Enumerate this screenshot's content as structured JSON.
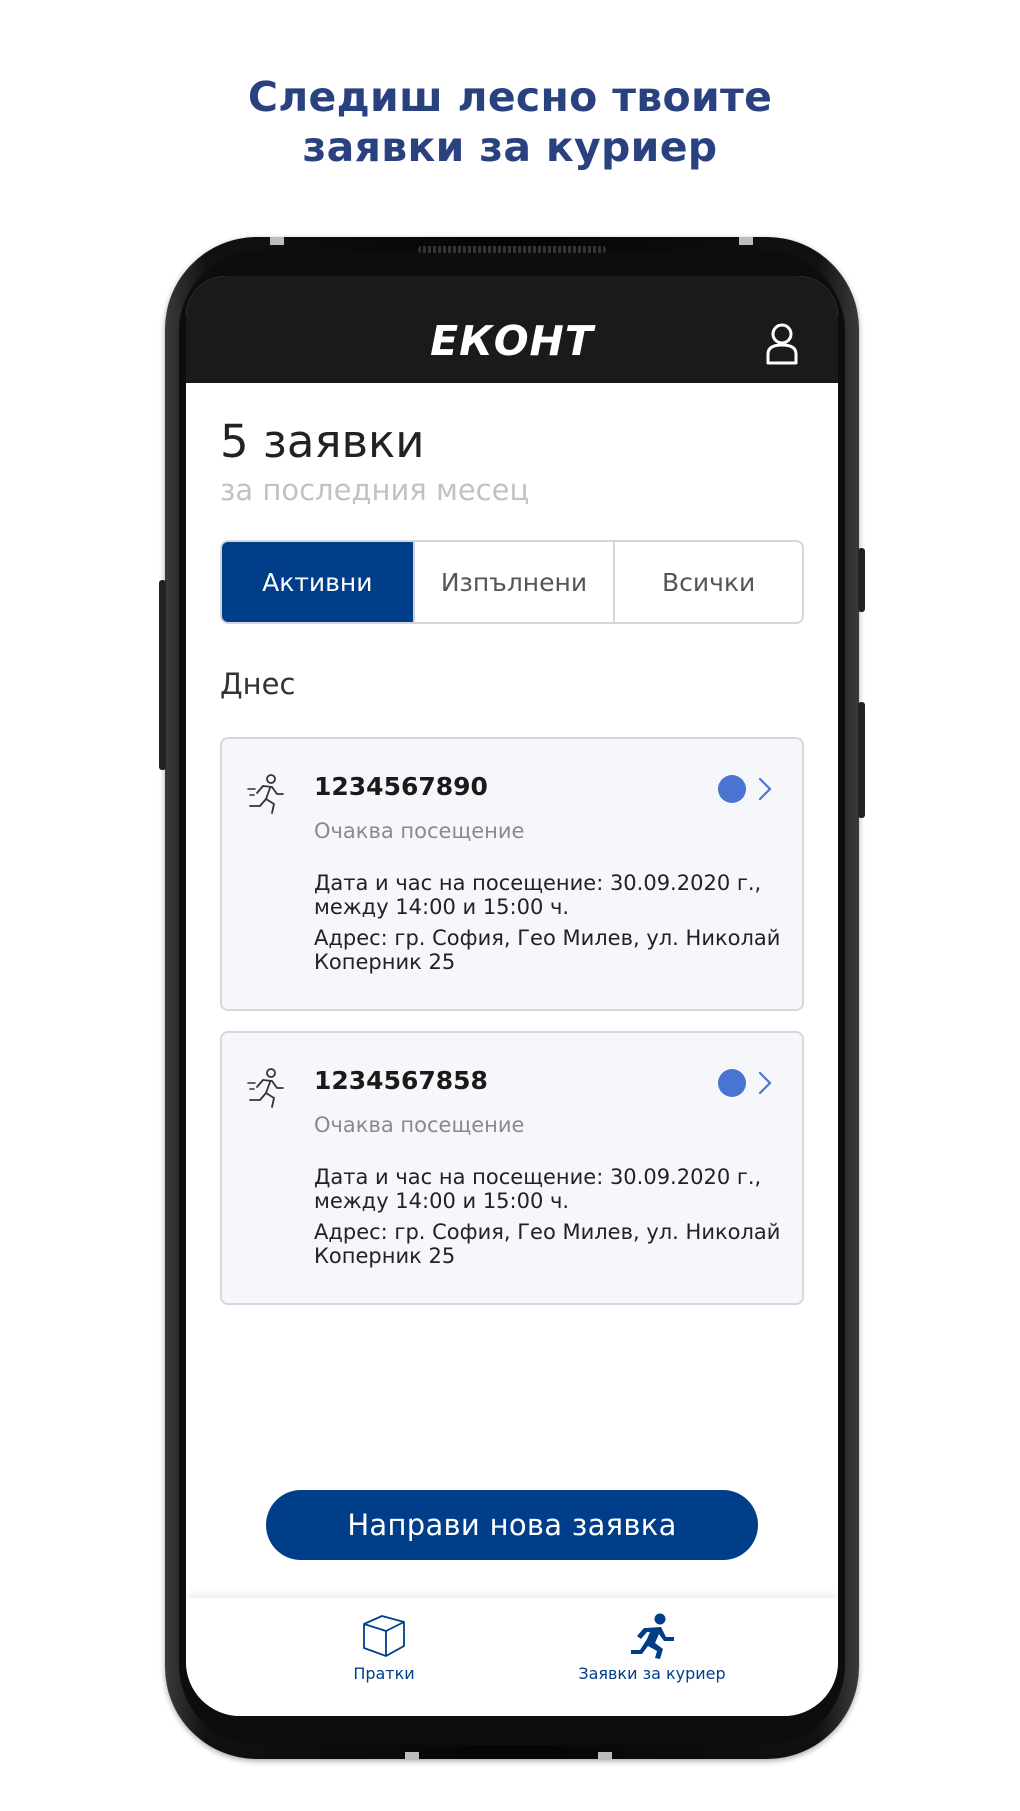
{
  "headline": {
    "line1": "Следиш лесно твоите",
    "line2": "заявки за куриер"
  },
  "app": {
    "logo": "ЕКОНТ",
    "profile_icon": "user-icon"
  },
  "summary": {
    "count": "5 заявки",
    "period": "за последния месец"
  },
  "tabs": [
    {
      "label": "Активни",
      "active": true
    },
    {
      "label": "Изпълнени",
      "active": false
    },
    {
      "label": "Всички",
      "active": false
    }
  ],
  "section": {
    "day": "Днес"
  },
  "requests": [
    {
      "number": "1234567890",
      "status": "Очаква посещение",
      "visit": "Дата и час на посещение: 30.09.2020 г., между 14:00 и 15:00 ч.",
      "address": "Адрес: гр. София, Гео Милев, ул. Николай Коперник 25",
      "status_color": "#4a74d1"
    },
    {
      "number": "1234567858",
      "status": "Очаква посещение",
      "visit": "Дата и час на посещение: 30.09.2020 г., между 14:00 и 15:00 ч.",
      "address": "Адрес: гр. София, Гео Милев, ул. Николай Коперник 25",
      "status_color": "#4a74d1"
    }
  ],
  "cta": {
    "label": "Направи нова заявка"
  },
  "bottom_nav": [
    {
      "label": "Пратки",
      "icon": "box-icon",
      "active": false
    },
    {
      "label": "Заявки за куриер",
      "icon": "courier-runner-icon",
      "active": true
    }
  ],
  "colors": {
    "brand": "#003e8a",
    "headline": "#2a4180",
    "status_dot": "#4a74d1"
  }
}
